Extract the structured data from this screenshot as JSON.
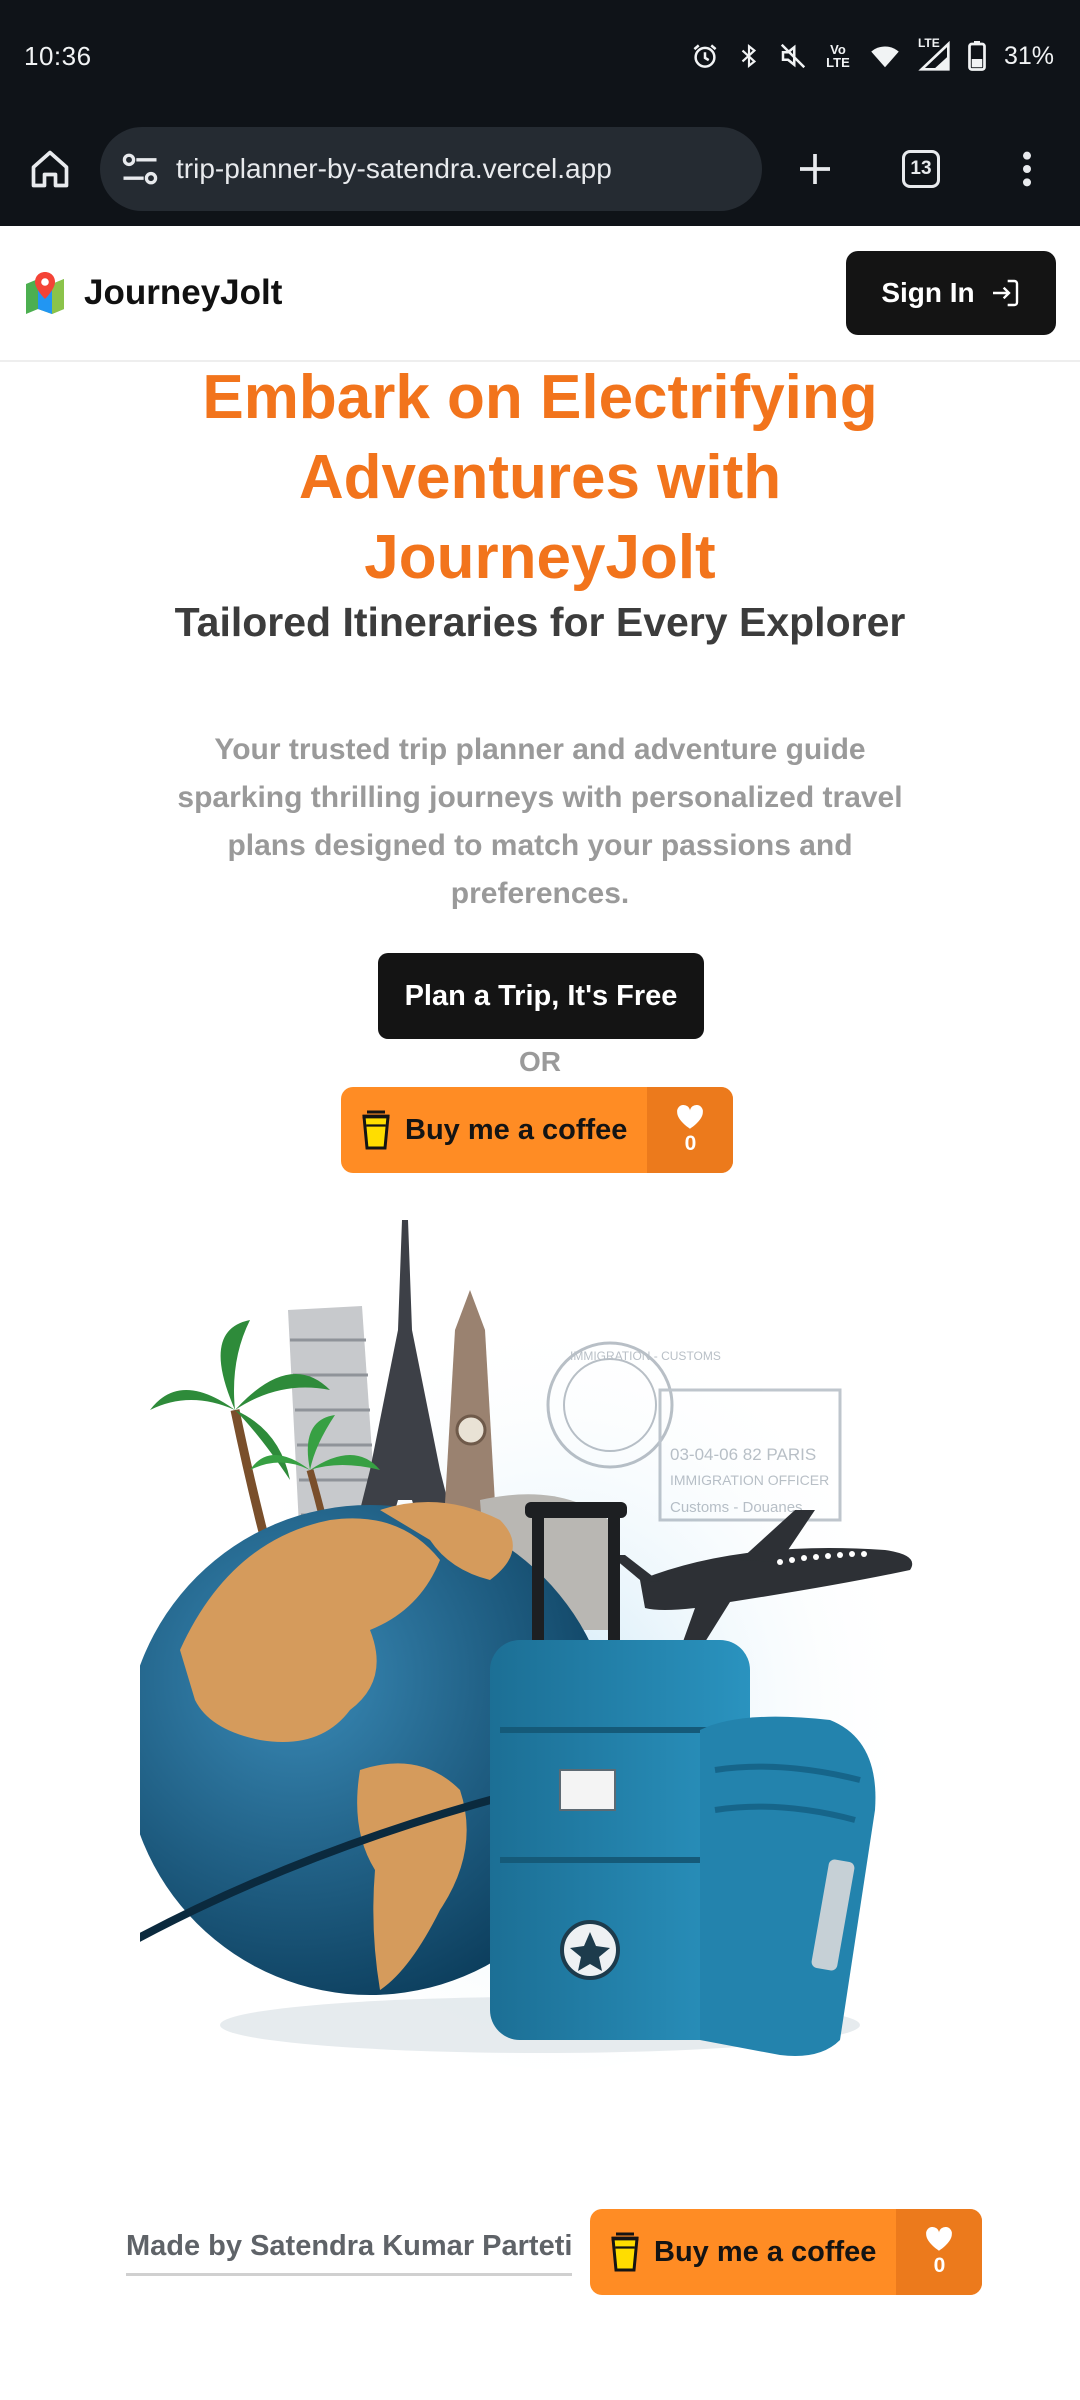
{
  "status_bar": {
    "time": "10:36",
    "network_label": "LTE",
    "volte_label": "Vo LTE",
    "battery": "31%"
  },
  "browser": {
    "url": "trip-planner-by-satendra.vercel.app",
    "tab_count": "13"
  },
  "header": {
    "brand": "JourneyJolt",
    "sign_in_label": "Sign In"
  },
  "hero": {
    "title": "Embark on Electrifying Adventures with JourneyJolt",
    "subtitle": "Tailored Itineraries for Every Explorer",
    "description": "Your trusted trip planner and adventure guide sparking thrilling journeys with personalized travel plans designed to match your passions and preferences.",
    "cta_label": "Plan a Trip, It's Free",
    "or_label": "OR"
  },
  "coffee": {
    "label": "Buy me a coffee",
    "count": "0"
  },
  "illustration": {
    "stamp_text_1": "IMMIGRATION - CUSTOMS",
    "stamp_text_2": "03-04-06  82  PARIS",
    "stamp_text_3": "IMMIGRATION OFFICER",
    "stamp_text_4": "Customs - Douanes"
  },
  "footer": {
    "credit": "Made by Satendra Kumar Parteti"
  },
  "colors": {
    "accent_orange": "#f2741c",
    "coffee_orange": "#ff8c24",
    "dark": "#141414",
    "chrome": "#0f1318"
  }
}
